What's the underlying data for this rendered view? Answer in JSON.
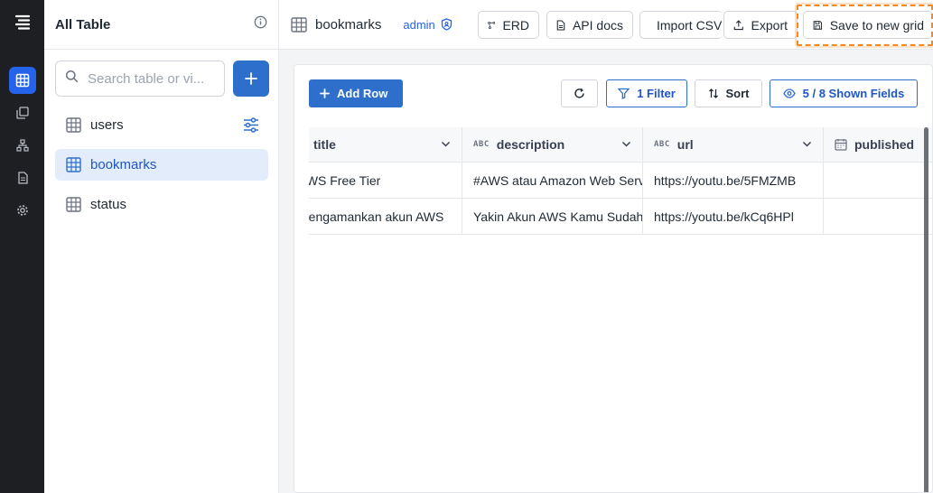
{
  "sidebar": {
    "title": "All Table",
    "search_placeholder": "Search table or vi...",
    "tables": [
      {
        "label": "users"
      },
      {
        "label": "bookmarks"
      },
      {
        "label": "status"
      }
    ]
  },
  "topbar": {
    "table_name": "bookmarks",
    "role": "admin",
    "erd_label": "ERD",
    "api_docs_label": "API docs",
    "import_label": "Import CSV",
    "export_label": "Export",
    "save_grid_label": "Save to new grid"
  },
  "toolbar": {
    "add_row_label": "Add Row",
    "filter_label": "1 Filter",
    "sort_label": "Sort",
    "fields_label": "5 / 8 Shown Fields"
  },
  "grid": {
    "columns": [
      {
        "label": "title",
        "type_badge": ""
      },
      {
        "label": "description",
        "type_badge": "ABC"
      },
      {
        "label": "url",
        "type_badge": "ABC"
      },
      {
        "label": "published",
        "type_badge": ""
      }
    ],
    "rows": [
      [
        "AWS Free Tier",
        "#AWS atau Amazon Web Services",
        "https://youtu.be/5FMZMB",
        ""
      ],
      [
        "Mengamankan akun AWS",
        "Yakin Akun AWS Kamu Sudah Aman?",
        "https://youtu.be/kCq6HPl",
        ""
      ]
    ]
  },
  "colors": {
    "accent": "#2f6fcc",
    "rail_bg": "#1e1f22",
    "highlight": "#f08a24"
  }
}
